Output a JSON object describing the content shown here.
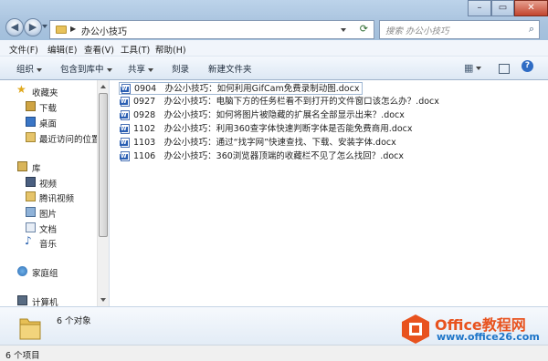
{
  "address": {
    "path": "办公小技巧"
  },
  "search": {
    "placeholder": "搜索 办公小技巧"
  },
  "menu": [
    "文件(F)",
    "编辑(E)",
    "查看(V)",
    "工具(T)",
    "帮助(H)"
  ],
  "toolbar": {
    "organize": "组织",
    "include": "包含到库中",
    "share": "共享",
    "burn": "刻录",
    "new_folder": "新建文件夹"
  },
  "nav": {
    "favorites": "收藏夹",
    "downloads": "下载",
    "desktop": "桌面",
    "recent": "最近访问的位置",
    "libraries": "库",
    "videos": "视频",
    "tencent_video": "腾讯视频",
    "pictures": "图片",
    "documents": "文档",
    "music": "音乐",
    "homegroup": "家庭组",
    "computer": "计算机"
  },
  "files": [
    "0904　办公小技巧：如何利用GifCam免费录制动图.docx",
    "0927　办公小技巧：电脑下方的任务栏看不到打开的文件窗口该怎么办？.docx",
    "0928　办公小技巧：如何将图片被隐藏的扩展名全部显示出来？.docx",
    "1102　办公小技巧：利用360查字体快速判断字体是否能免费商用.docx",
    "1103　办公小技巧：通过“找字网”快速查找、下载、安装字体.docx",
    "1106　办公小技巧：360浏览器顶端的收藏栏不见了怎么找回？.docx"
  ],
  "details": {
    "count": "6 个对象"
  },
  "status": {
    "count": "6 个项目"
  },
  "watermark": {
    "brand": "Office教程网",
    "url": "www.office26.com"
  },
  "colors": {
    "logo_orange": "#e8521e",
    "logo_blue": "#1e75c8",
    "selection_border": "#9fb7d3"
  }
}
